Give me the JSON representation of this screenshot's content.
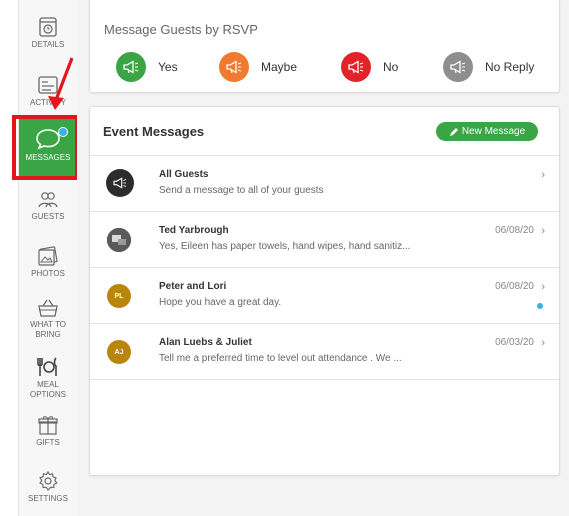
{
  "sidebar": {
    "items": [
      {
        "label": "DETAILS",
        "icon": "clock-icon"
      },
      {
        "label": "ACTIVITY",
        "icon": "activity-icon"
      },
      {
        "label": "MESSAGES",
        "icon": "chat-bubble-icon",
        "active": true
      },
      {
        "label": "GUESTS",
        "icon": "guests-icon"
      },
      {
        "label": "PHOTOS",
        "icon": "photos-icon"
      },
      {
        "label": "WHAT TO BRING",
        "icon": "basket-icon"
      },
      {
        "label": "MEAL OPTIONS",
        "icon": "utensils-icon"
      },
      {
        "label": "GIFTS",
        "icon": "gift-icon"
      },
      {
        "label": "SETTINGS",
        "icon": "gear-icon"
      }
    ]
  },
  "rsvp": {
    "title": "Message Guests by RSVP",
    "buttons": [
      {
        "label": "Yes",
        "color": "#3aa545",
        "icon": "megaphone-icon"
      },
      {
        "label": "Maybe",
        "color": "#f07a2e",
        "icon": "megaphone-icon"
      },
      {
        "label": "No",
        "color": "#e3232a",
        "icon": "megaphone-icon"
      },
      {
        "label": "No Reply",
        "color": "#8e8e8e",
        "icon": "megaphone-icon"
      }
    ]
  },
  "messages": {
    "title": "Event Messages",
    "new_button": "New Message",
    "rows": [
      {
        "name": "All Guests",
        "preview": "Send a message to all of your guests",
        "date": "",
        "avatar": "",
        "avatar_color": "#2c2c2c",
        "unread": false
      },
      {
        "name": "Ted Yarbrough",
        "preview": "Yes, Eileen has paper towels, hand wipes, hand sanitiz...",
        "date": "06/08/20",
        "avatar": "",
        "avatar_color": "#4a4a4a",
        "unread": false
      },
      {
        "name": "Peter and Lori",
        "preview": "Hope you have a great day.",
        "date": "06/08/20",
        "avatar": "PL",
        "avatar_color": "#b8860b",
        "unread": true
      },
      {
        "name": "Alan Luebs & Juliet",
        "preview": "Tell me a preferred time to level out attendance . We ...",
        "date": "06/03/20",
        "avatar": "AJ",
        "avatar_color": "#b8860b",
        "unread": false
      }
    ]
  },
  "colors": {
    "accent": "#3aa545",
    "highlight": "#e3161c",
    "badge": "#3bb0e6"
  }
}
